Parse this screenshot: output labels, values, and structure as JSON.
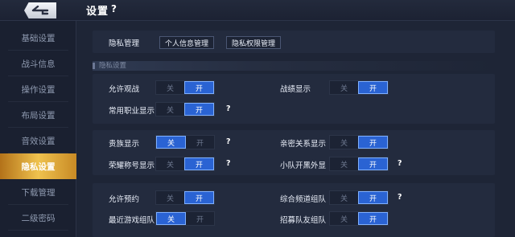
{
  "header": {
    "title": "设置",
    "help": "?"
  },
  "sidebar": {
    "items": [
      {
        "label": "基础设置",
        "active": false
      },
      {
        "label": "战斗信息",
        "active": false
      },
      {
        "label": "操作设置",
        "active": false
      },
      {
        "label": "布局设置",
        "active": false
      },
      {
        "label": "音效设置",
        "active": false
      },
      {
        "label": "隐私设置",
        "active": true
      },
      {
        "label": "下载管理",
        "active": false
      },
      {
        "label": "二级密码",
        "active": false
      }
    ]
  },
  "privacy_manage": {
    "label": "隐私管理",
    "personal_info_btn": "个人信息管理",
    "permission_btn": "隐私权限管理"
  },
  "section_title": "隐私设置",
  "toggle_text": {
    "off": "关",
    "on": "开"
  },
  "settings": {
    "allow_watch": {
      "label": "允许观战",
      "value": "on"
    },
    "record_display": {
      "label": "战绩显示",
      "value": "on"
    },
    "common_role_display": {
      "label": "常用职业显示",
      "value": "on",
      "help": "?"
    },
    "noble_display": {
      "label": "贵族显示",
      "value": "off",
      "help": "?"
    },
    "intimacy_display": {
      "label": "亲密关系显示",
      "value": "on"
    },
    "honor_title_display": {
      "label": "荣耀称号显示",
      "value": "on",
      "help": "?"
    },
    "team_appearance": {
      "label": "小队开黑外显",
      "value": "on",
      "help": "?"
    },
    "allow_booking": {
      "label": "允许预约",
      "value": "on"
    },
    "channel_team": {
      "label": "综合频道组队",
      "value": "on",
      "help": "?"
    },
    "recent_team": {
      "label": "最近游戏组队",
      "value": "off"
    },
    "recruit_team": {
      "label": "招募队友组队",
      "value": "on"
    }
  },
  "colors": {
    "accent": "#2a63d3",
    "active_tab": "#e6b544",
    "background": "#1e2536"
  }
}
